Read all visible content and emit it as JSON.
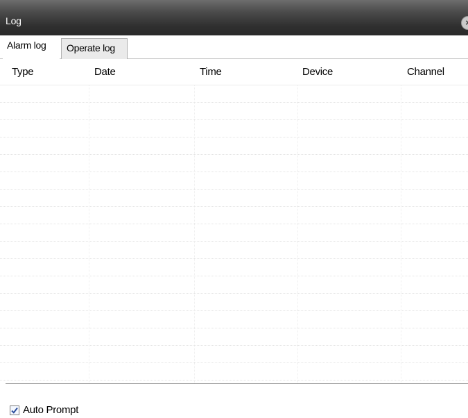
{
  "window": {
    "title": "Log",
    "close_glyph": "×"
  },
  "tabs": [
    {
      "label": "Alarm log",
      "active": true
    },
    {
      "label": "Operate log",
      "active": false
    }
  ],
  "table": {
    "columns": [
      "Type",
      "Date",
      "Time",
      "Device",
      "Channel"
    ],
    "rows": []
  },
  "footer": {
    "auto_prompt_label": "Auto Prompt",
    "auto_prompt_checked": true
  },
  "icons": {
    "close": "close-icon",
    "check": "checkmark-icon"
  },
  "colors": {
    "titlebar": "#3a3a3a",
    "checkmark": "#2a4d9b"
  }
}
